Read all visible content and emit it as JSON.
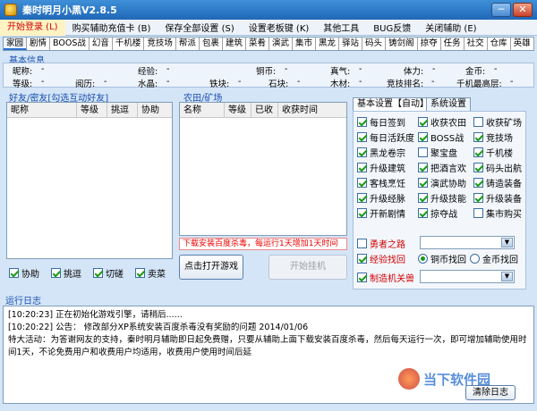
{
  "window": {
    "title": "秦时明月小黑V2.8.5",
    "minimize": "─",
    "close": "✕"
  },
  "menu": [
    "开始登录 (L)",
    "购买辅助充值卡 (B)",
    "保存全部设置 (S)",
    "设置老板键 (K)",
    "其他工具",
    "BUG反馈",
    "关闭辅助 (E)"
  ],
  "tabs": [
    "家园",
    "剧情",
    "BOOS战",
    "幻音",
    "千机楼",
    "竞技场",
    "帮派",
    "包裹",
    "建筑",
    "菜肴",
    "演武",
    "集市",
    "黑龙",
    "驿站",
    "码头",
    "铸剑阁",
    "掠夺",
    "任务",
    "社交",
    "仓库",
    "英雄"
  ],
  "basic_info": {
    "title": "基本信息",
    "row1": [
      [
        "昵称:",
        "-"
      ],
      [
        "经验:",
        "-"
      ],
      [
        "铜币:",
        "-"
      ],
      [
        "真气:",
        "-"
      ],
      [
        "体力:",
        "-"
      ],
      [
        "金币:",
        "-"
      ]
    ],
    "row2": [
      [
        "等级:",
        "-"
      ],
      [
        "阅历:",
        "-"
      ],
      [
        "水晶:",
        "-"
      ],
      [
        "铁块:",
        "-"
      ],
      [
        "石块:",
        "-"
      ],
      [
        "木材:",
        "-"
      ],
      [
        "竞技排名:",
        "-"
      ],
      [
        "千机最高层:",
        "-"
      ]
    ]
  },
  "friends": {
    "title": "好友/密友[勾选互动好友]",
    "columns": [
      "昵称",
      "等级",
      "挑逗",
      "协助"
    ],
    "options": [
      "协助",
      "挑逗",
      "切磋",
      "卖菜"
    ]
  },
  "farm": {
    "title": "农田/矿场",
    "columns": [
      "名称",
      "等级",
      "已收",
      "收获时间"
    ]
  },
  "notice": "下载安装百度杀毒，每运行1天增加1天时间",
  "buttons": {
    "open_game": "点击打开游戏",
    "start_hang": "开始挂机",
    "clear_log": "清除日志"
  },
  "settings": {
    "tabs": [
      "基本设置【自动】",
      "系统设置"
    ],
    "options": [
      [
        "每日签到",
        true
      ],
      [
        "收获农田",
        true
      ],
      [
        "收获矿场",
        false
      ],
      [
        "每日活跃度",
        true
      ],
      [
        "BOSS战",
        true
      ],
      [
        "竞技场",
        true
      ],
      [
        "黑龙卷宗",
        true
      ],
      [
        "聚宝盘",
        false
      ],
      [
        "千机楼",
        true
      ],
      [
        "升级建筑",
        true
      ],
      [
        "把酒言欢",
        true
      ],
      [
        "码头出航",
        true
      ],
      [
        "客栈烹饪",
        true
      ],
      [
        "演武协助",
        true
      ],
      [
        "铸造装备",
        true
      ],
      [
        "升级经脉",
        true
      ],
      [
        "升级技能",
        true
      ],
      [
        "升级装备",
        true
      ],
      [
        "开新剧情",
        true
      ],
      [
        "掠夺战",
        true
      ],
      [
        "集市购买",
        false
      ]
    ],
    "hero_road": "勇者之路",
    "exp_find": "经验找回",
    "radio_copper": "铜币找回",
    "radio_gold": "金币找回",
    "mech_pass": "制造机关兽"
  },
  "log": {
    "title": "运行日志",
    "lines": [
      "[10:20:23] 正在初始化游戏引擎，请稍后......",
      "[10:20:22] 公告：  修改部分XP系统安装百度杀毒没有奖励的问题 2014/01/06",
      "          特大活动：为答谢网友的支持，秦时明月辅助即日起免费赠，只要从辅助上面下载安装百度杀毒，然后每天运行一次，即可增加辅助使用时间1天，不论免费用户和收费用户均适用，收费用户使用时间后延"
    ]
  },
  "watermark": "当下软件园"
}
